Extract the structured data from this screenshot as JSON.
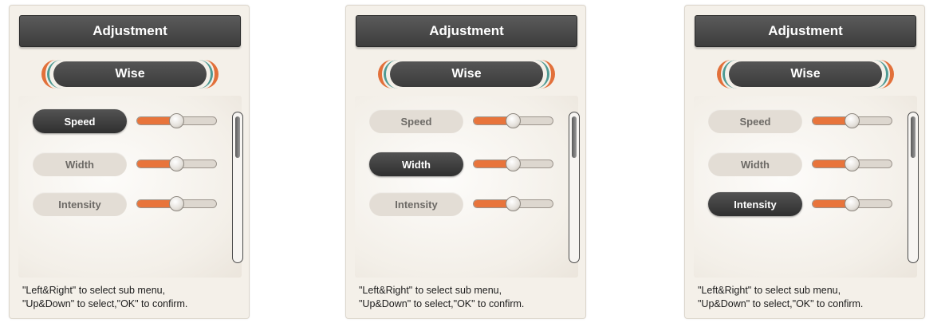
{
  "screens": [
    {
      "title": "Adjustment",
      "mode": "Wise",
      "selected_index": 0,
      "settings": [
        {
          "label": "Speed",
          "level": 0.5
        },
        {
          "label": "Width",
          "level": 0.5
        },
        {
          "label": "Intensity",
          "level": 0.5
        }
      ],
      "scroll_position": 0,
      "help_lines": [
        "\"Left&Right\" to select sub menu,",
        "\"Up&Down\" to select,\"OK\" to confirm."
      ]
    },
    {
      "title": "Adjustment",
      "mode": "Wise",
      "selected_index": 1,
      "settings": [
        {
          "label": "Speed",
          "level": 0.5
        },
        {
          "label": "Width",
          "level": 0.5
        },
        {
          "label": "Intensity",
          "level": 0.5
        }
      ],
      "scroll_position": 0,
      "help_lines": [
        "\"Left&Right\" to select sub menu,",
        "\"Up&Down\" to select,\"OK\" to confirm."
      ]
    },
    {
      "title": "Adjustment",
      "mode": "Wise",
      "selected_index": 2,
      "settings": [
        {
          "label": "Speed",
          "level": 0.5
        },
        {
          "label": "Width",
          "level": 0.5
        },
        {
          "label": "Intensity",
          "level": 0.5
        }
      ],
      "scroll_position": 0,
      "help_lines": [
        "\"Left&Right\" to select sub menu,",
        "\"Up&Down\" to select,\"OK\" to confirm."
      ]
    }
  ],
  "colors": {
    "accent_orange": "#e8743b",
    "accent_teal": "#4e9a93",
    "active_dark": "#3b3b3b",
    "panel_bg": "#f4f0e9"
  }
}
